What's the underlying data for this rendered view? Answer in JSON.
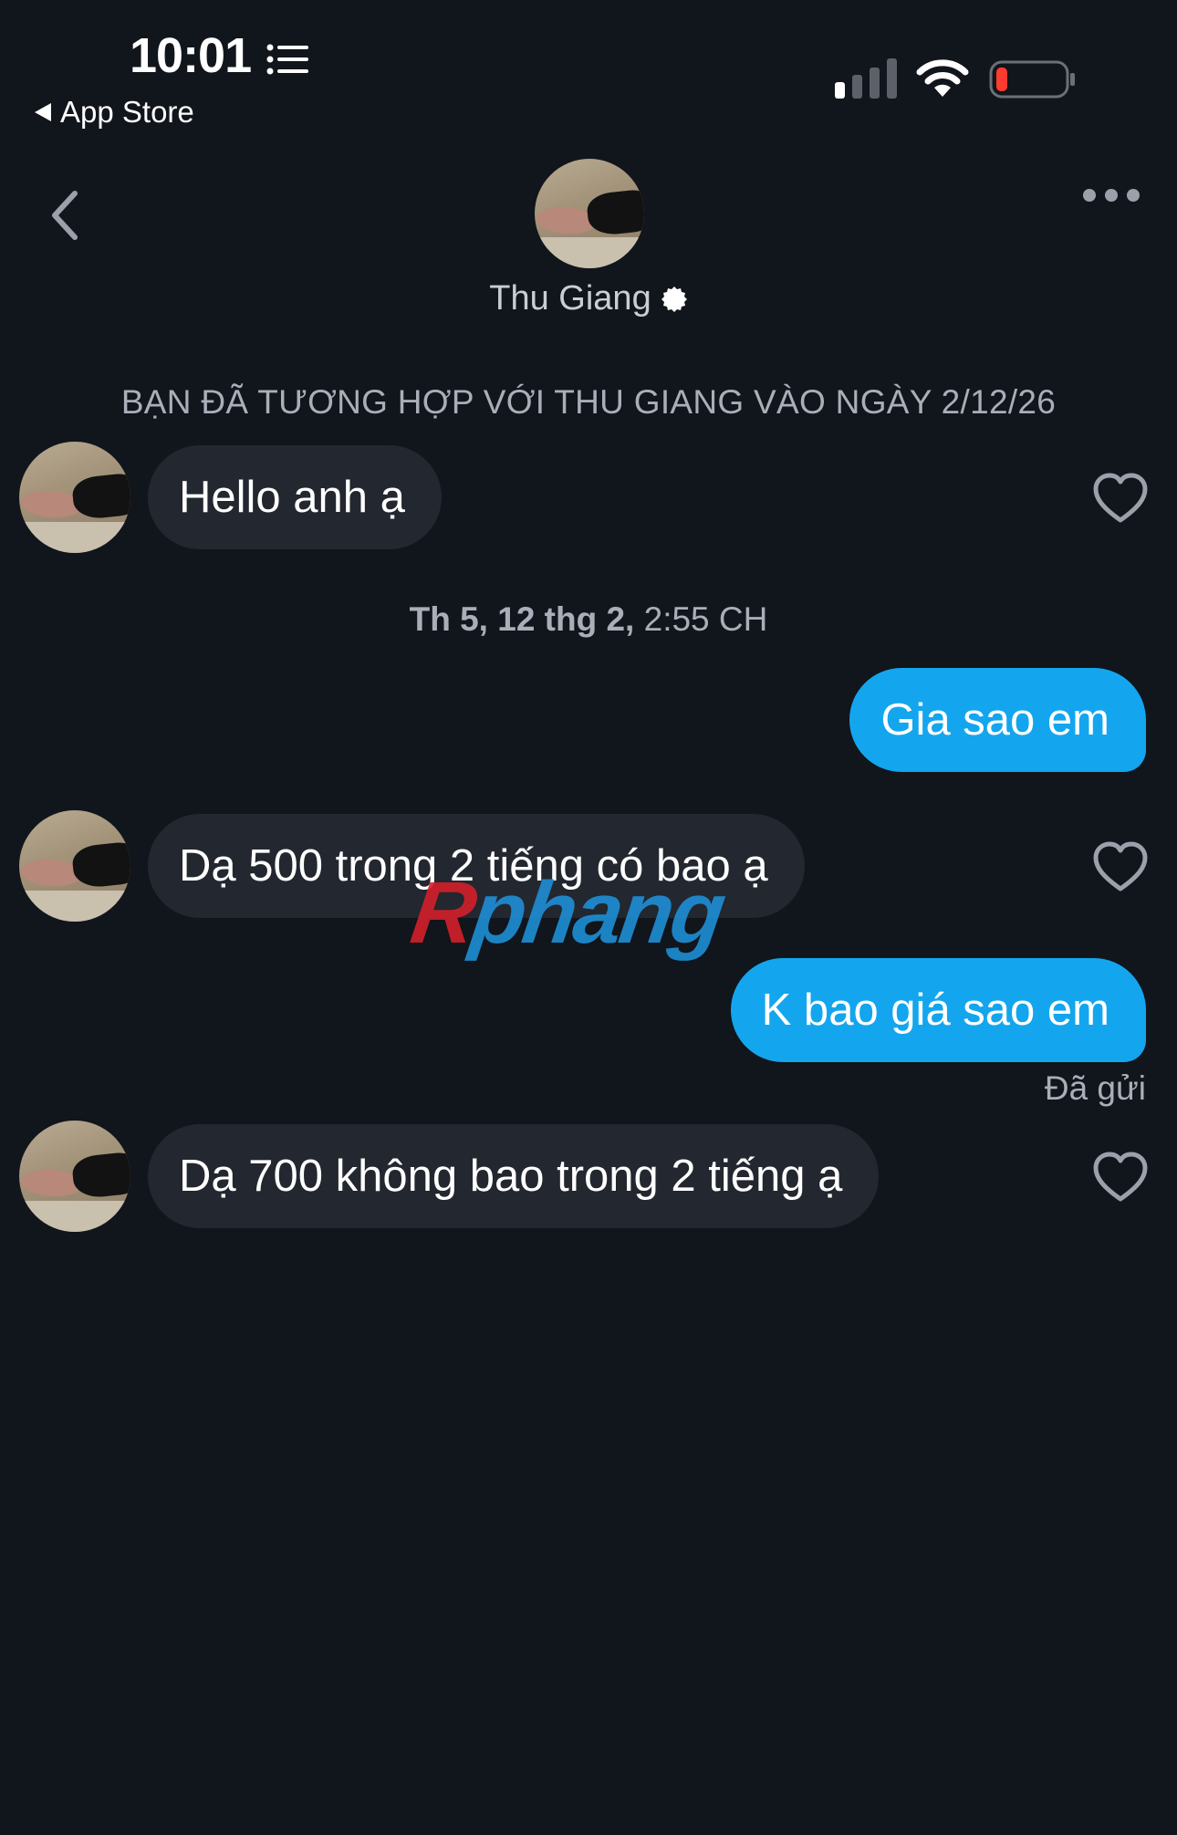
{
  "status_bar": {
    "time": "10:01",
    "back_app_label": "App Store"
  },
  "header": {
    "contact_name": "Thu Giang"
  },
  "chat": {
    "match_banner": "BẠN ĐÃ TƯƠNG HỢP VỚI THU GIANG VÀO NGÀY 2/12/26",
    "timestamp_bold": "Th 5, 12 thg 2,",
    "timestamp_time": "2:55 CH",
    "messages": [
      {
        "direction": "in",
        "text": "Hello anh ạ"
      },
      {
        "direction": "out",
        "text": "Gia sao em"
      },
      {
        "direction": "in",
        "text": "Dạ 500 trong 2 tiếng có bao ạ"
      },
      {
        "direction": "out",
        "text": "K bao giá sao em"
      },
      {
        "direction": "in",
        "text": "Dạ 700 không bao trong 2 tiếng ạ"
      }
    ],
    "sent_status": "Đã gửi"
  },
  "watermark": {
    "part_a": "R",
    "part_b": "phang"
  },
  "colors": {
    "background": "#11151c",
    "incoming_bubble": "#23272f",
    "outgoing_bubble": "#13a6ee",
    "muted_text": "#a9afb9",
    "battery_low": "#ff3b30"
  },
  "icons": [
    "list-icon",
    "signal-icon",
    "wifi-icon",
    "battery-icon",
    "chevron-left-icon",
    "more-icon",
    "verified-badge-icon",
    "heart-icon"
  ]
}
